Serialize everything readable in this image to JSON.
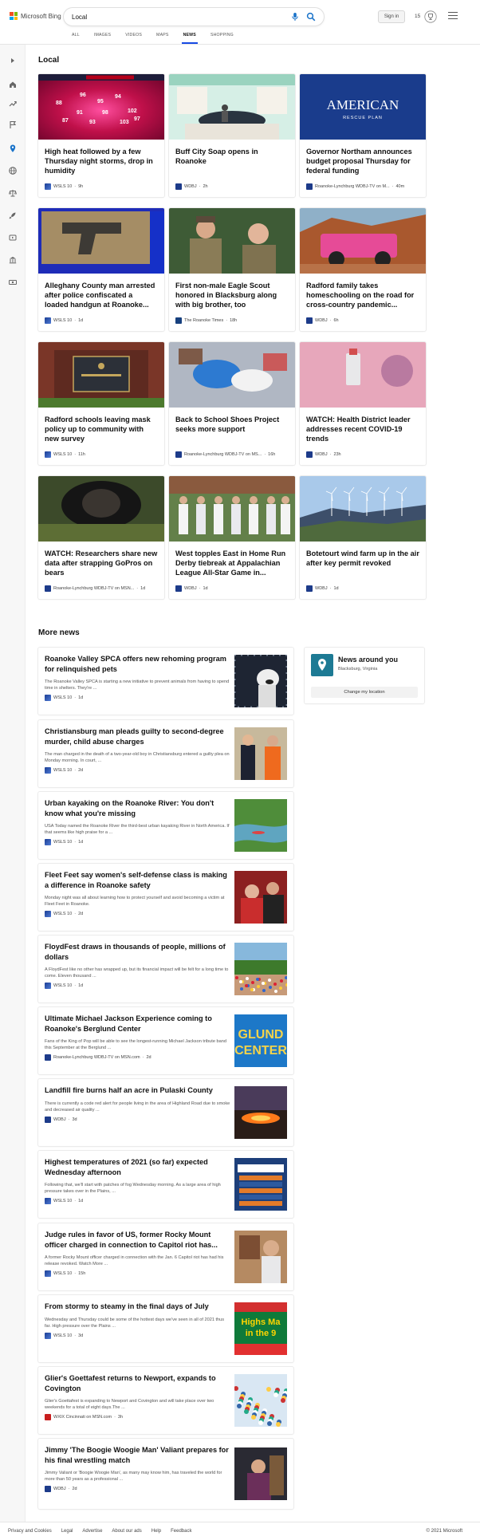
{
  "header": {
    "brand": "Microsoft Bing",
    "search_value": "Local",
    "sign_in": "Sign in",
    "points": "15"
  },
  "tabs": [
    "ALL",
    "IMAGES",
    "VIDEOS",
    "MAPS",
    "NEWS",
    "SHOPPING"
  ],
  "active_tab": "NEWS",
  "left_rail_icons": [
    "expand-icon",
    "home-icon",
    "trending-icon",
    "flag-icon",
    "location-pin-icon",
    "globe-icon",
    "scales-icon",
    "rocket-icon",
    "entertainment-icon",
    "bank-icon",
    "money-icon"
  ],
  "local": {
    "title": "Local",
    "cards": [
      {
        "title": "High heat followed by a few Thursday night storms, drop in humidity",
        "source": "WSLS 10",
        "time": "9h",
        "image": "weather-map"
      },
      {
        "title": "Buff City Soap opens in Roanoke",
        "source": "WDBJ",
        "time": "2h",
        "image": "soap-store"
      },
      {
        "title": "Governor Northam announces budget proposal Thursday for federal funding",
        "source": "Roanoke-Lynchburg WDBJ-TV on M...",
        "time": "40m",
        "image": "american-rescue-plan"
      },
      {
        "title": "Alleghany County man arrested after police confiscated a loaded handgun at Roanoke...",
        "source": "WSLS 10",
        "time": "1d",
        "image": "handgun"
      },
      {
        "title": "First non-male Eagle Scout honored in Blacksburg along with big brother, too",
        "source": "The Roanoke Times",
        "time": "18h",
        "image": "scouts"
      },
      {
        "title": "Radford family takes homeschooling on the road for cross-country pandemic...",
        "source": "WDBJ",
        "time": "6h",
        "image": "pink-jeep"
      },
      {
        "title": "Radford schools leaving mask policy up to community with new survey",
        "source": "WSLS 10",
        "time": "11h",
        "image": "school-sign"
      },
      {
        "title": "Back to School Shoes Project seeks more support",
        "source": "Roanoke-Lynchburg WDBJ-TV on MS...",
        "time": "16h",
        "image": "shoes"
      },
      {
        "title": "WATCH: Health District leader addresses recent COVID-19 trends",
        "source": "WDBJ",
        "time": "23h",
        "image": "vaccine"
      },
      {
        "title": "WATCH: Researchers share new data after strapping GoPros on bears",
        "source": "Roanoke-Lynchburg WDBJ-TV on MSN...",
        "time": "1d",
        "image": "bear"
      },
      {
        "title": "West topples East in Home Run Derby tiebreak at Appalachian League All-Star Game in...",
        "source": "WDBJ",
        "time": "1d",
        "image": "baseball"
      },
      {
        "title": "Botetourt wind farm up in the air after key permit revoked",
        "source": "WDBJ",
        "time": "1d",
        "image": "wind-farm"
      }
    ]
  },
  "more_news": {
    "title": "More news",
    "items": [
      {
        "title": "Roanoke Valley SPCA offers new rehoming program for relinquished pets",
        "snippet": "The Roanoke Valley SPCA is starting a new initiative to prevent animals from having to spend time in shelters. They're ...",
        "source": "WSLS 10",
        "time": "1d",
        "image": "dog"
      },
      {
        "title": "Christiansburg man pleads guilty to second-degree murder, child abuse charges",
        "snippet": "The man charged in the death of a two-year-old boy in Christiansburg entered a guilty plea on Monday morning. In court, ...",
        "source": "WSLS 10",
        "time": "2d",
        "image": "court"
      },
      {
        "title": "Urban kayaking on the Roanoke River: You don't know what you're missing",
        "snippet": "USA Today named the Roanoke River the third-best urban kayaking River in North America. If that seems like high praise for a ...",
        "source": "WSLS 10",
        "time": "1d",
        "image": "river"
      },
      {
        "title": "Fleet Feet say women's self-defense class is making a difference in Roanoke safety",
        "snippet": "Monday night was all about learning how to protect yourself and avoid becoming a victim at Fleet Feet in Roanoke.",
        "source": "WSLS 10",
        "time": "2d",
        "image": "class"
      },
      {
        "title": "FloydFest draws in thousands of people, millions of dollars",
        "snippet": "A FloydFest like no other has wrapped up, but its financial impact will be felt for a long time to come. Eleven thousand ...",
        "source": "WSLS 10",
        "time": "1d",
        "image": "festival"
      },
      {
        "title": "Ultimate Michael Jackson Experience coming to Roanoke's Berglund Center",
        "snippet": "Fans of the King of Pop will be able to see the longest-running Michael Jackson tribute band this September at the Berglund ...",
        "source": "Roanoke-Lynchburg WDBJ-TV on MSN.com",
        "time": "2d",
        "image": "berglund",
        "image_text": "GLUND\nCENTER"
      },
      {
        "title": "Landfill fire burns half an acre in Pulaski County",
        "snippet": "There is currently a code red alert for people living in the area of Highland Road due to smoke and decreased air quality ...",
        "source": "WDBJ",
        "time": "3d",
        "image": "fire"
      },
      {
        "title": "Highest temperatures of 2021 (so far) expected Wednesday afternoon",
        "snippet": "Following that, we'll start with patches of fog Wednesday morning. As a large area of high pressure takes over in the Plains, ...",
        "source": "WSLS 10",
        "time": "1d",
        "image": "forecast"
      },
      {
        "title": "Judge rules in favor of US, former Rocky Mount officer charged in connection to Capitol riot has...",
        "snippet": "A former Rocky Mount officer charged in connection with the Jan. 6 Capitol riot has had his release revoked. Watch More ...",
        "source": "WSLS 10",
        "time": "15h",
        "image": "officer"
      },
      {
        "title": "From stormy to steamy in the final days of July",
        "snippet": "Wednesday and Thursday could be some of the hottest days we've seen in all of 2021 thus far. High pressure over the Plains ...",
        "source": "WSLS 10",
        "time": "3d",
        "image": "steamy",
        "image_text": "Highs Ma\nin the 9"
      },
      {
        "title": "Glier's Goettafest returns to Newport, expands to Covington",
        "snippet": "Glier's Goettafest is expanding to Newport and Covington and will take place over two weekends for a total of eight days.The ...",
        "source": "WXIX Cincinnati on MSN.com",
        "time": "3h",
        "image": "crowd"
      },
      {
        "title": "Jimmy 'The Boogie Woogie Man' Valiant prepares for his final wrestling match",
        "snippet": "Jimmy Valiant or 'Boogie Woogie Man', as many may know him, has traveled the world for more than 50 years as a professional ...",
        "source": "WDBJ",
        "time": "2d",
        "image": "wrestling"
      }
    ]
  },
  "news_around": {
    "title": "News around you",
    "location": "Blacksburg, Virginia",
    "button": "Change my location"
  },
  "footer": {
    "links": [
      "Privacy and Cookies",
      "Legal",
      "Advertise",
      "About our ads",
      "Help",
      "Feedback"
    ],
    "copyright": "© 2021 Microsoft"
  },
  "image_texts": {
    "american_rescue_1": "AMERICAN",
    "american_rescue_2": "RESCUE PLAN",
    "weather_banner": "FUTURE TRACKER",
    "weather_brand": "WEATHER"
  },
  "colors": {
    "accent": "#174ae4",
    "brand_teal": "#1d7a94"
  }
}
